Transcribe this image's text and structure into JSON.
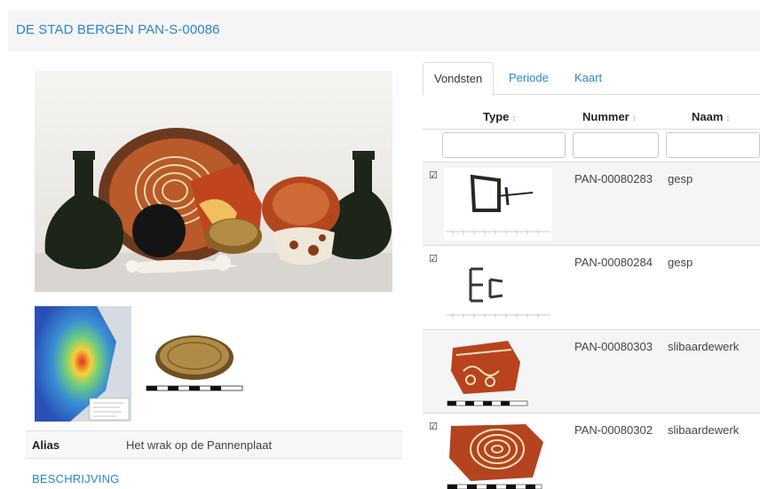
{
  "page": {
    "title": "DE STAD BERGEN PAN-S-00086"
  },
  "details": {
    "alias_label": "Alias",
    "alias_value": "Het wrak op de Pannenplaat",
    "description_heading": "BESCHRIJVING"
  },
  "tabs": [
    {
      "label": "Vondsten",
      "active": true
    },
    {
      "label": "Periode",
      "active": false
    },
    {
      "label": "Kaart",
      "active": false
    }
  ],
  "table": {
    "columns": [
      {
        "label": "Type",
        "sort": "↕"
      },
      {
        "label": "Nummer",
        "sort": "↕"
      },
      {
        "label": "Naam",
        "sort": "↕"
      }
    ],
    "rows": [
      {
        "number": "PAN-00080283",
        "name": "gesp",
        "checked": true,
        "image": "buckle"
      },
      {
        "number": "PAN-00080284",
        "name": "gesp",
        "checked": true,
        "image": "buckle-fragments"
      },
      {
        "number": "PAN-00080303",
        "name": "slibaardewerk",
        "checked": false,
        "image": "slipware-sherd"
      },
      {
        "number": "PAN-00080302",
        "name": "slibaardewerk",
        "checked": true,
        "image": "slipware-sherd-spiral"
      }
    ]
  },
  "colors": {
    "link": "#2a86c9",
    "header_bg": "#f5f5f5",
    "border": "#dddddd"
  },
  "icons": {
    "checkbox": "checkbox-checked-icon",
    "sort": "sort-icon"
  }
}
